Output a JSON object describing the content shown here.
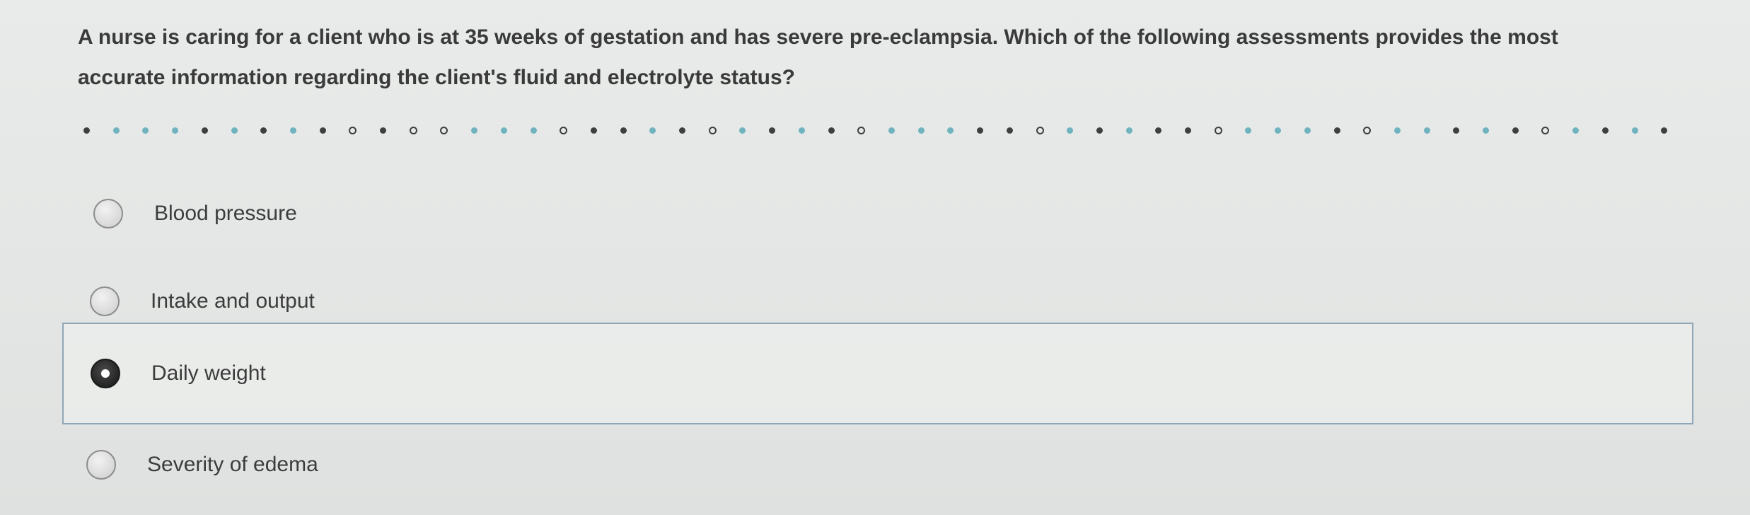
{
  "question": {
    "line1": "A nurse is caring for a client who is at 35 weeks of gestation and has severe pre-eclampsia. Which of the following assessments provides the most",
    "line2": "accurate information regarding the client's fluid and electrolyte status?"
  },
  "options": [
    {
      "label": "Blood pressure",
      "selected": false
    },
    {
      "label": "Intake and output",
      "selected": false
    },
    {
      "label": "Daily weight",
      "selected": true
    },
    {
      "label": "Severity of edema",
      "selected": false
    }
  ],
  "colors": {
    "background": "#e6e8e7",
    "selected_border": "#8fa6b6",
    "text": "#3a3a3a",
    "dot_teal": "#6fb3bf"
  }
}
